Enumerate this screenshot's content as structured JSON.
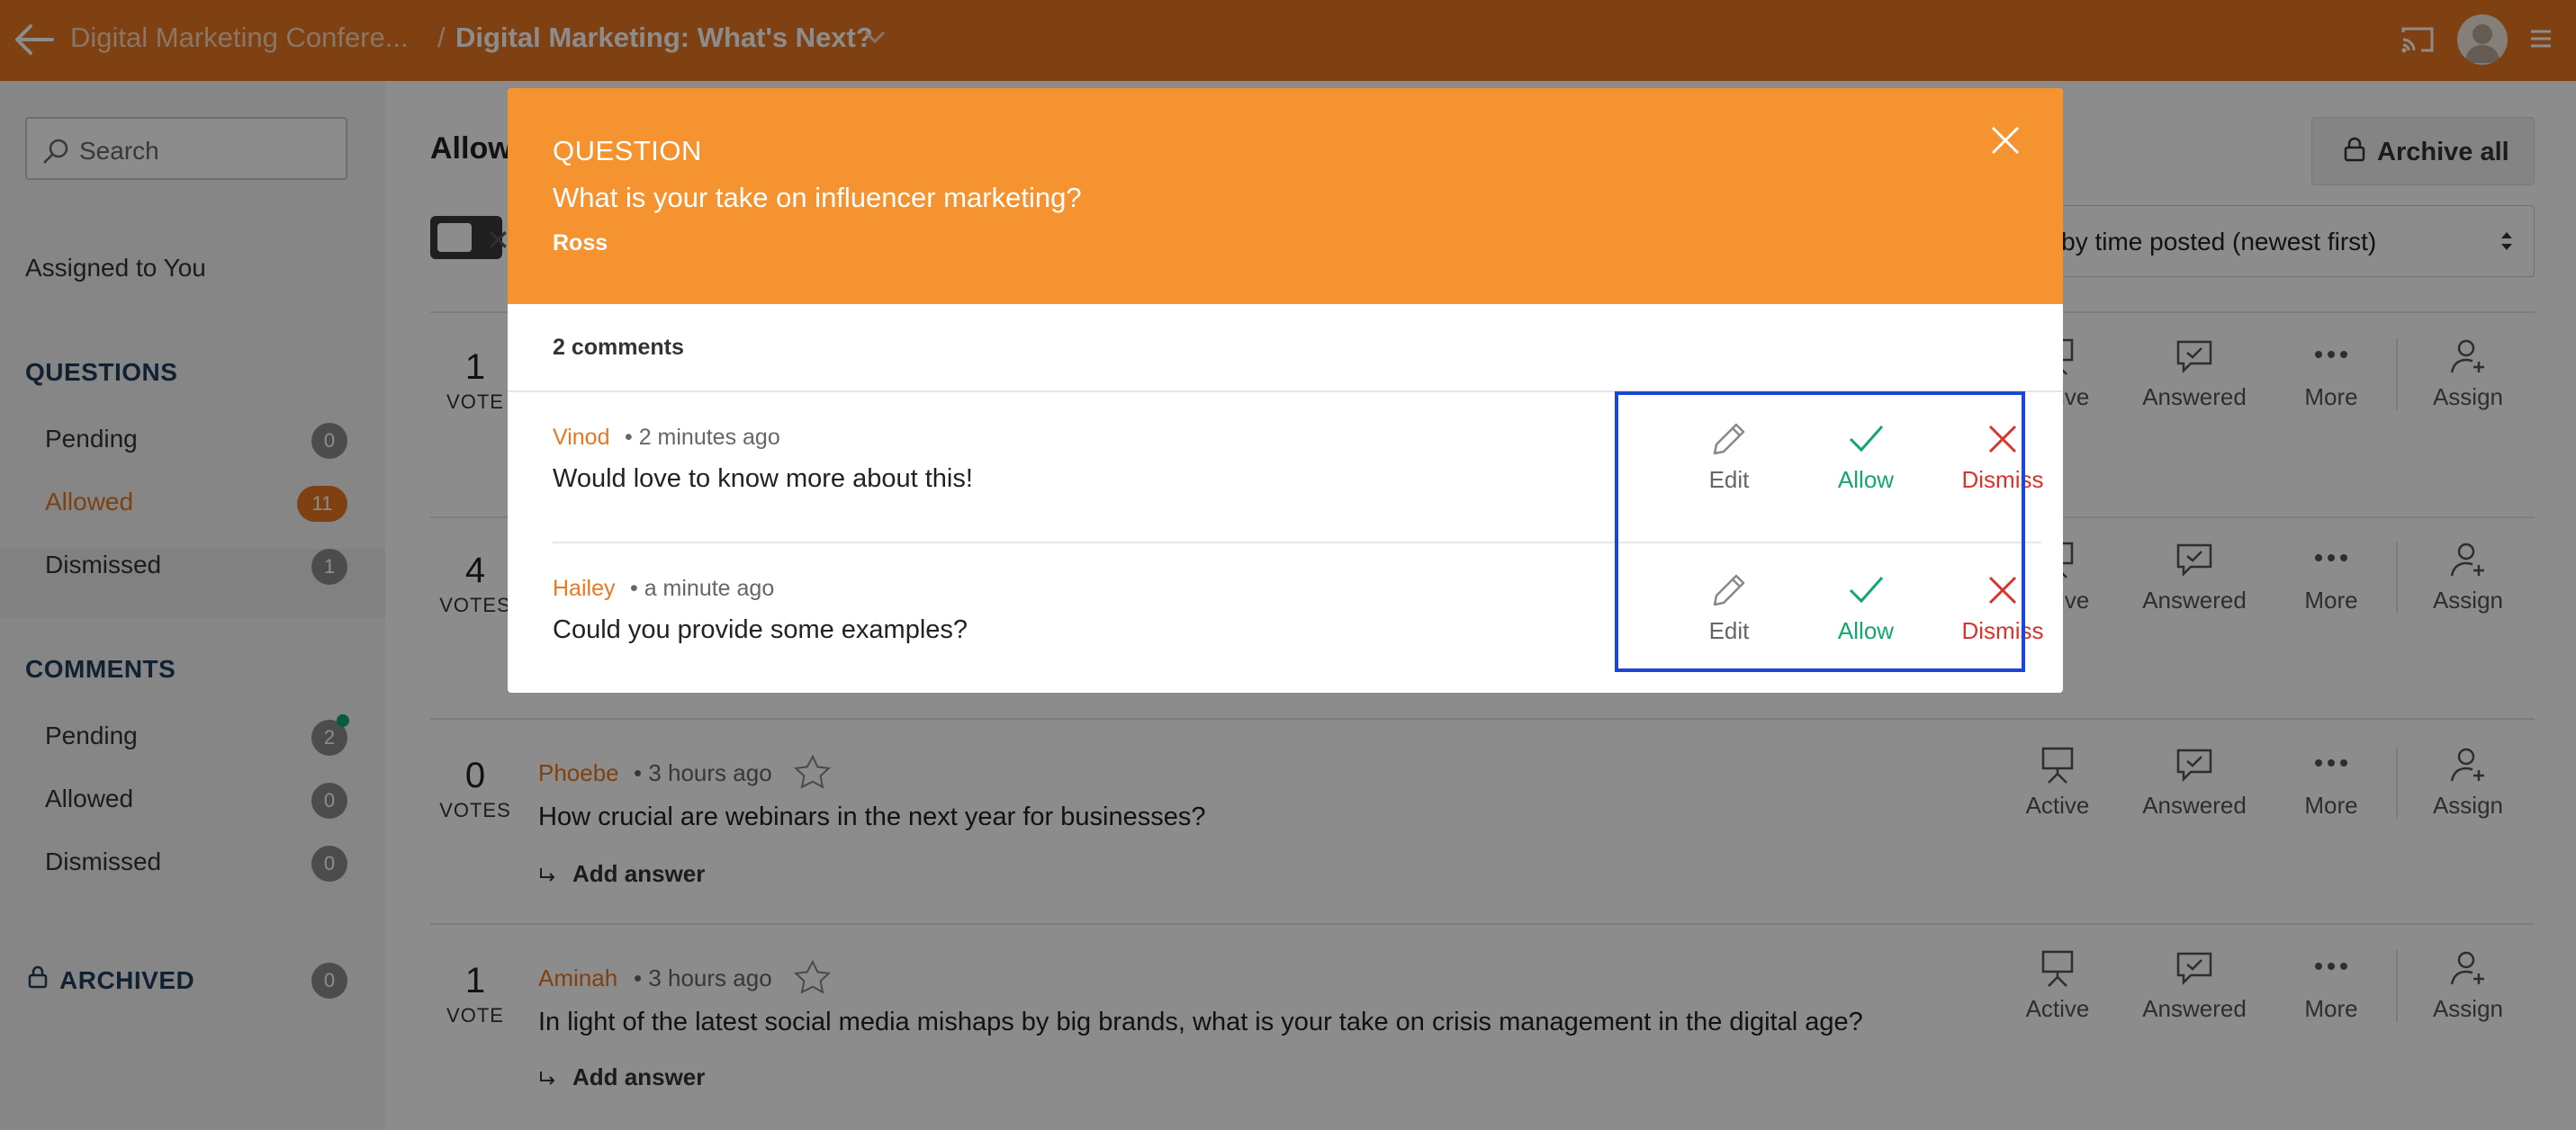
{
  "topbar": {
    "breadcrumb_event": "Digital Marketing Confere...",
    "separator": "/",
    "breadcrumb_session": "Digital Marketing: What's Next?"
  },
  "sidebar": {
    "search_placeholder": "Search",
    "assigned": "Assigned to You",
    "questions_heading": "QUESTIONS",
    "questions": [
      {
        "label": "Pending",
        "count": "0"
      },
      {
        "label": "Allowed",
        "count": "11"
      },
      {
        "label": "Dismissed",
        "count": "1"
      }
    ],
    "comments_heading": "COMMENTS",
    "comments": [
      {
        "label": "Pending",
        "count": "2"
      },
      {
        "label": "Allowed",
        "count": "0"
      },
      {
        "label": "Dismissed",
        "count": "0"
      }
    ],
    "archived": {
      "label": "ARCHIVED",
      "count": "0"
    }
  },
  "main": {
    "title": "Allowed",
    "archive_all": "Archive all",
    "sort": "Sort by time posted (newest first)",
    "actions": {
      "active": "Active",
      "answered": "Answered",
      "more": "More",
      "assign": "Assign"
    },
    "add_answer": "Add answer",
    "questions": [
      {
        "votes": "1",
        "votes_label": "VOTE"
      },
      {
        "votes": "4",
        "votes_label": "VOTES"
      },
      {
        "votes": "0",
        "votes_label": "VOTES",
        "author": "Phoebe",
        "time": "• 3 hours ago",
        "text": "How crucial are webinars in the next year for businesses?"
      },
      {
        "votes": "1",
        "votes_label": "VOTE",
        "author": "Aminah",
        "time": "• 3 hours ago",
        "text": "In light of the latest social media mishaps by big brands, what is your take on crisis management in the digital age?"
      }
    ]
  },
  "modal": {
    "label": "QUESTION",
    "question": "What is your take on influencer marketing?",
    "author": "Ross",
    "comment_count": "2 comments",
    "actions": {
      "edit": "Edit",
      "allow": "Allow",
      "dismiss": "Dismiss"
    },
    "comments": [
      {
        "author": "Vinod",
        "time": "• 2 minutes ago",
        "text": "Would love to know more about this!"
      },
      {
        "author": "Hailey",
        "time": "• a minute ago",
        "text": "Could you provide some examples?"
      }
    ]
  },
  "colors": {
    "brand": "#e8771f",
    "modal_header": "#f69331",
    "allow": "#12a86b",
    "dismiss": "#d9342b",
    "highlight": "#1c46d6"
  }
}
